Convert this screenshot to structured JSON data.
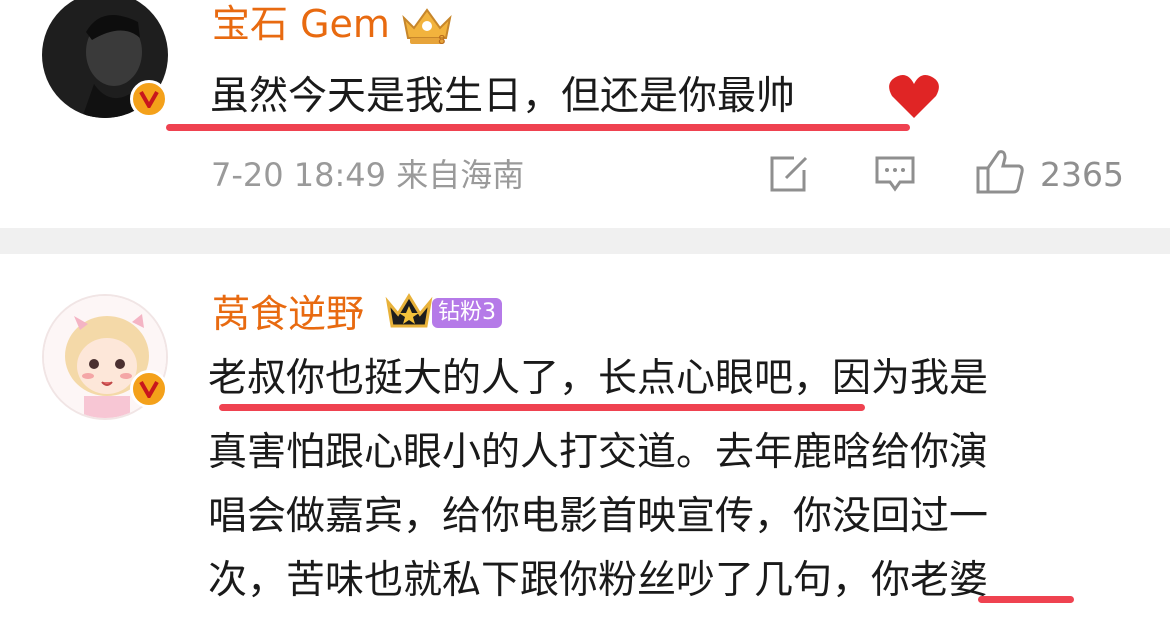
{
  "comments": [
    {
      "username": "宝石 Gem",
      "text": "虽然今天是我生日，但还是你最帅",
      "timestamp": "7-20 18:49 来自海南",
      "likes": "2365"
    },
    {
      "username": "莴食逆野",
      "fan_badge": "钻粉3",
      "lines": [
        "老叔你也挺大的人了，长点心眼吧，因为我是",
        "真害怕跟心眼小的人打交道。去年鹿晗给你演",
        "唱会做嘉宾，给你电影首映宣传，你没回过一",
        "次，苦味也就私下跟你粉丝吵了几句，你老婆"
      ]
    }
  ],
  "colors": {
    "username": "#e86a10",
    "underline": "#ef4250",
    "meta": "#9a9a9a",
    "fan_badge": "#b57ae8",
    "divider": "#f0f0f0"
  }
}
